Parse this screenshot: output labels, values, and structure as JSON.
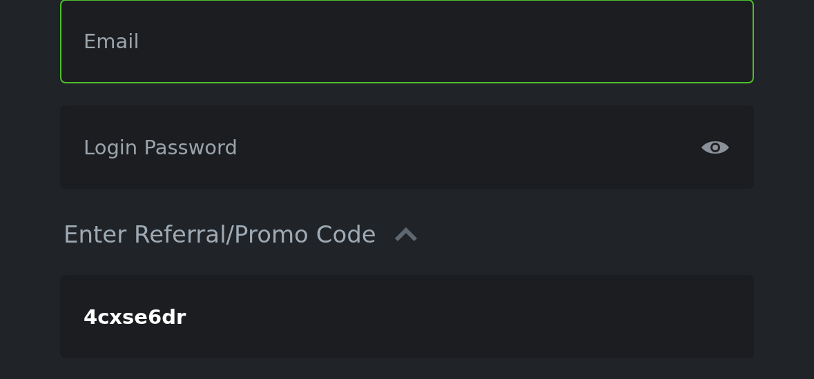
{
  "email": {
    "placeholder": "Email",
    "focused": true
  },
  "password": {
    "placeholder": "Login Password"
  },
  "referral": {
    "label": "Enter Referral/Promo Code",
    "expanded": true,
    "value": "4cxse6dr"
  }
}
